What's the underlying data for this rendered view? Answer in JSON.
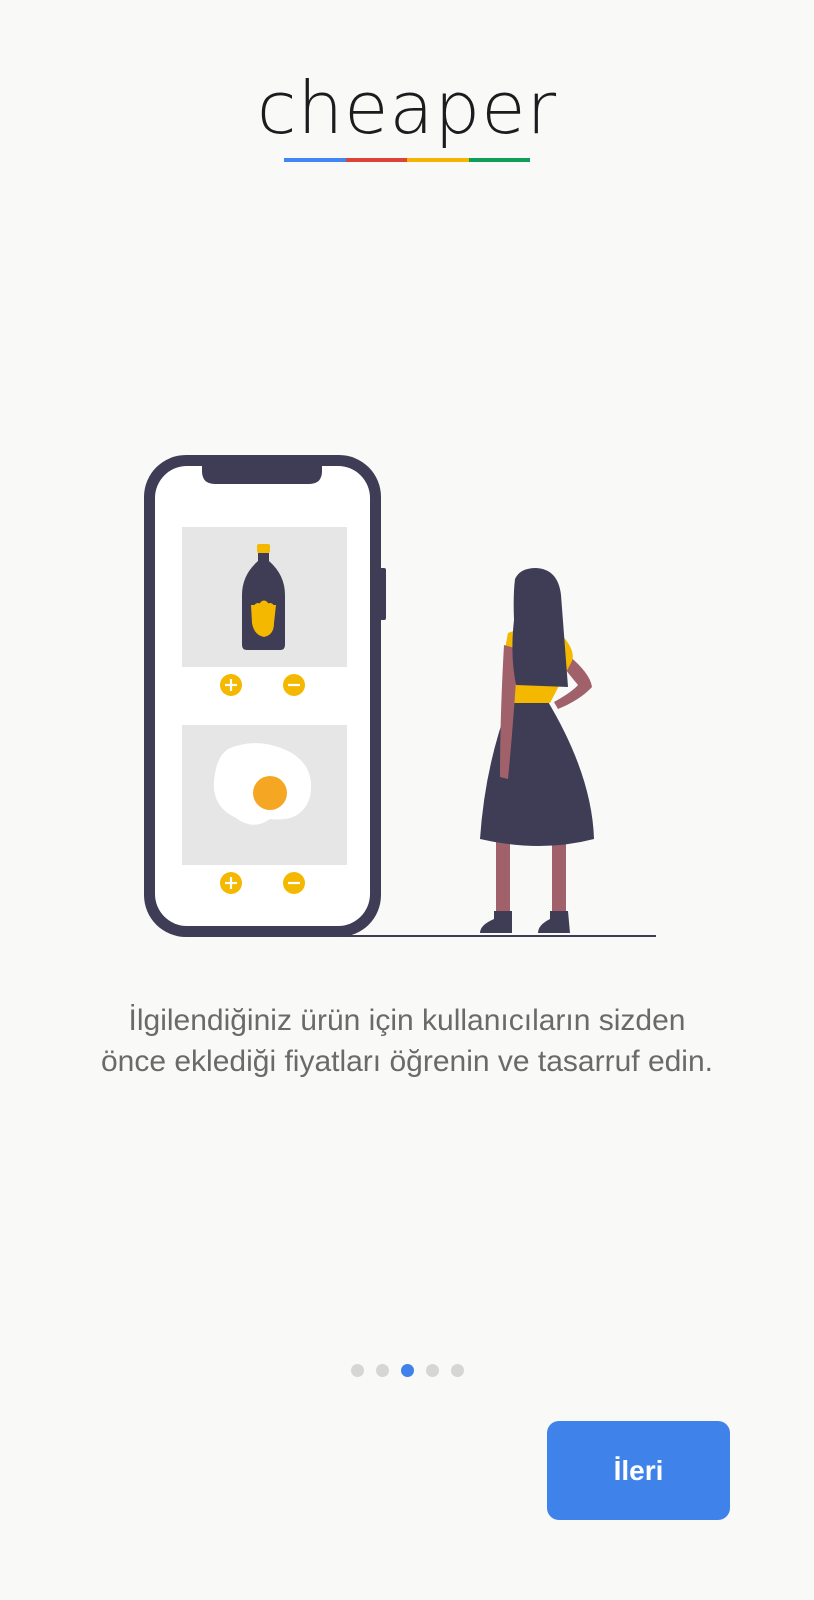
{
  "app": {
    "logo_text": "cheaper",
    "logo_underline_colors": [
      "#4285f4",
      "#db4437",
      "#f4b400",
      "#0f9d58"
    ]
  },
  "onboarding": {
    "description": "İlgilendiğiniz ürün için kullanıcıların sizden önce eklediği fiyatları öğrenin ve tasarruf edin.",
    "illustration_icons": [
      "phone-icon",
      "bottle-icon",
      "fried-egg-icon",
      "plus-icon",
      "minus-icon",
      "woman-figure-icon"
    ],
    "pager": {
      "total": 5,
      "active_index": 2
    },
    "next_label": "İleri"
  },
  "colors": {
    "background": "#f9f9f8",
    "accent": "#3f82ea",
    "illustration_dark": "#3f3d56",
    "illustration_yellow": "#f5b800",
    "egg_yolk": "#f5a623",
    "card_gray": "#e6e6e6",
    "skin": "#a0616a",
    "text_gray": "#6a6a6a",
    "dot_inactive": "#d6d6d6"
  }
}
